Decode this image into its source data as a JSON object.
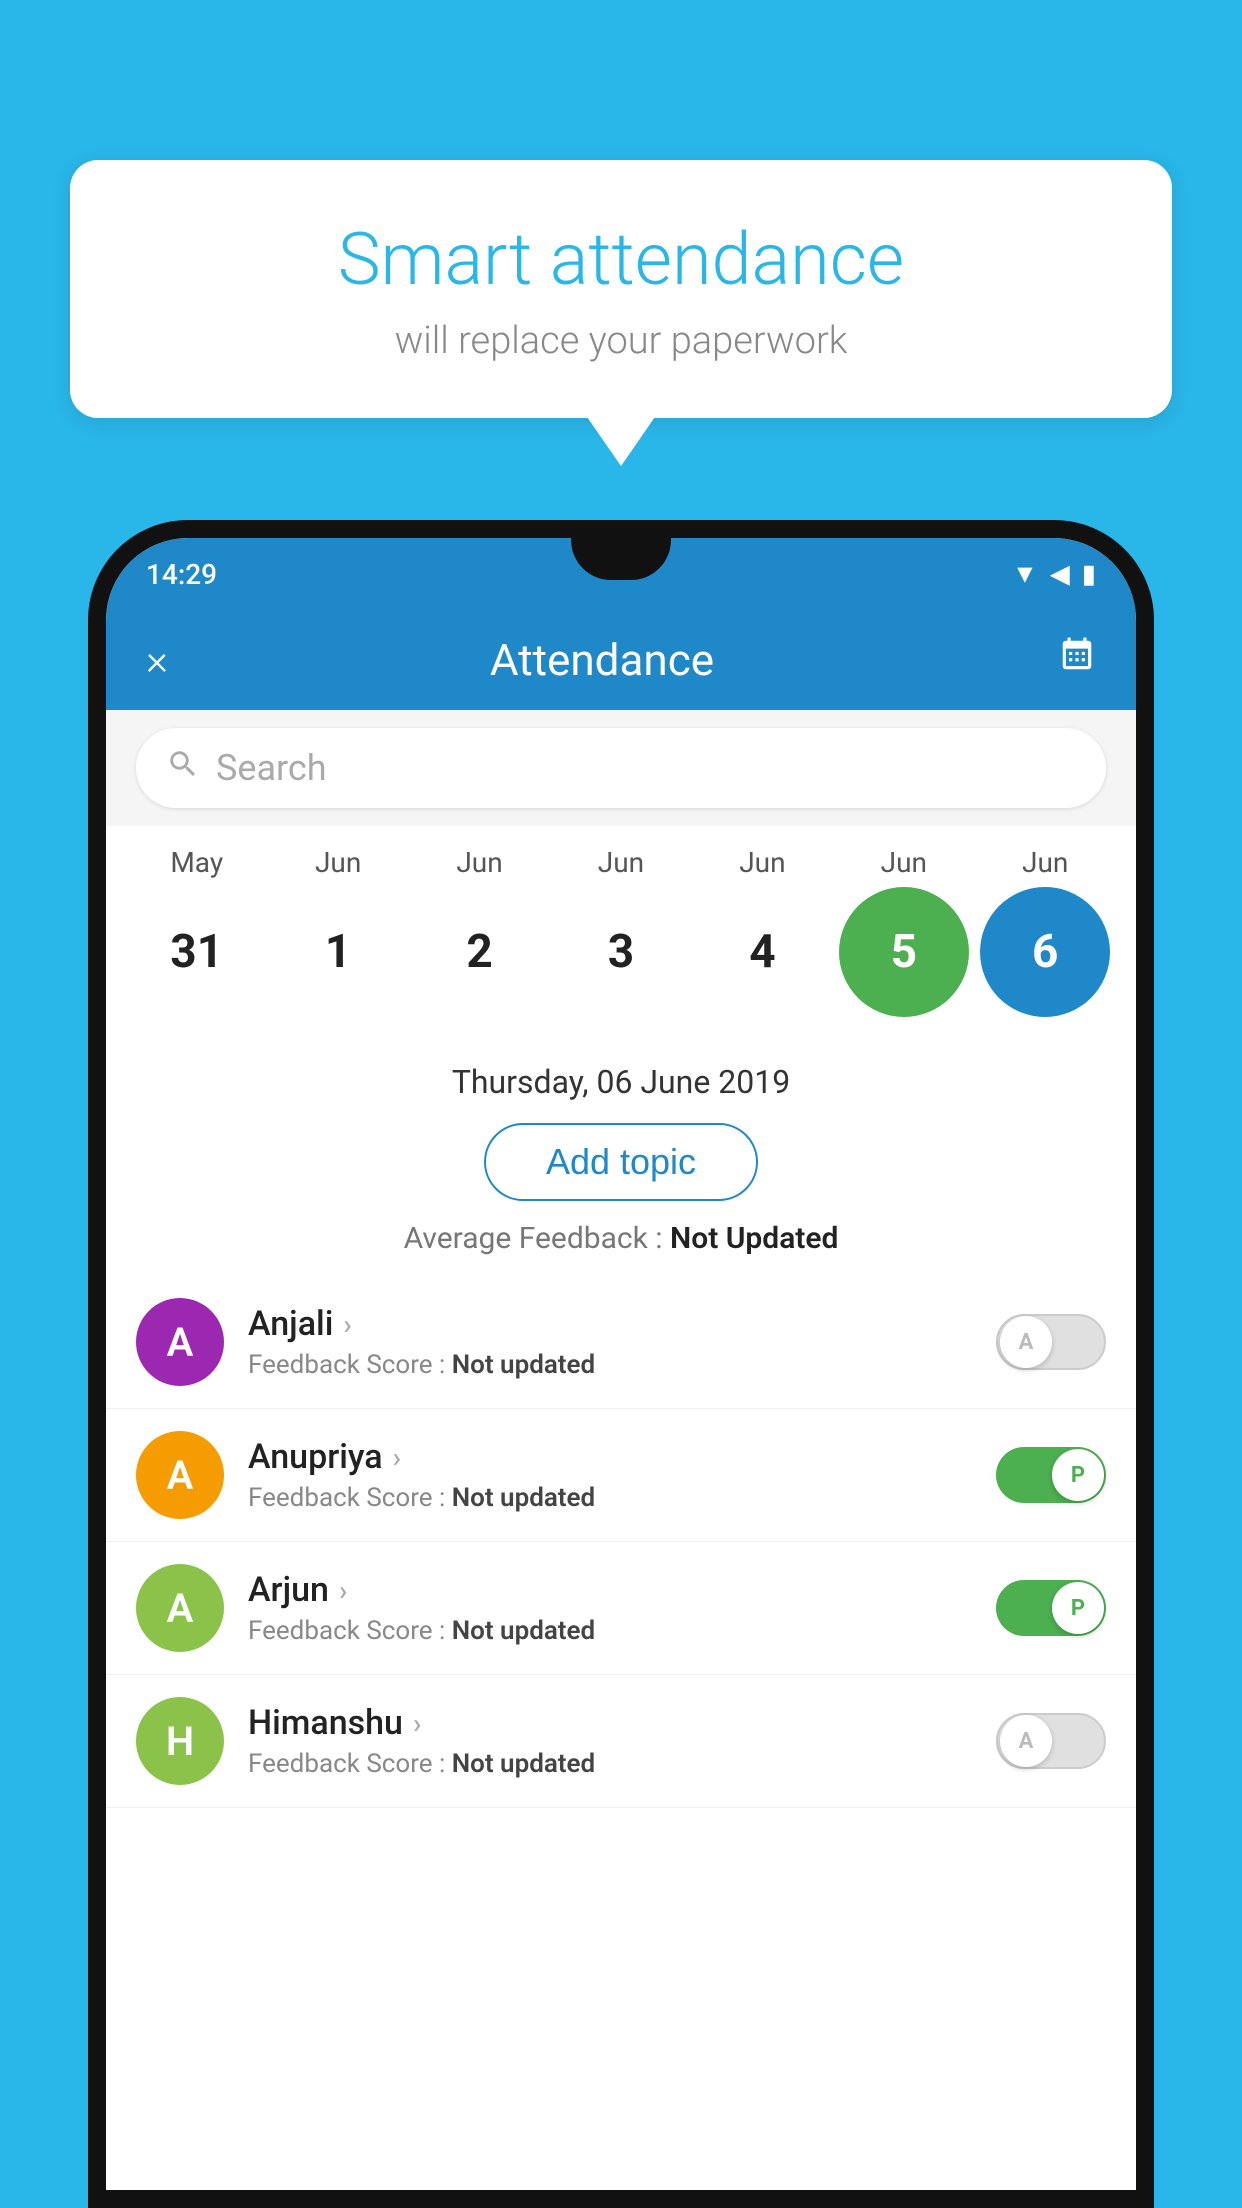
{
  "background_color": "#29B6E8",
  "speech_bubble": {
    "title": "Smart attendance",
    "subtitle": "will replace your paperwork"
  },
  "status_bar": {
    "time": "14:29"
  },
  "app_header": {
    "title": "Attendance",
    "close_label": "×",
    "calendar_icon": "calendar-icon"
  },
  "search": {
    "placeholder": "Search"
  },
  "calendar": {
    "months": [
      "May",
      "Jun",
      "Jun",
      "Jun",
      "Jun",
      "Jun",
      "Jun"
    ],
    "days": [
      "31",
      "1",
      "2",
      "3",
      "4",
      "5",
      "6"
    ],
    "states": [
      "normal",
      "normal",
      "normal",
      "normal",
      "normal",
      "selected-green",
      "selected-blue"
    ]
  },
  "selected_date": "Thursday, 06 June 2019",
  "add_topic_label": "Add topic",
  "average_feedback": {
    "label": "Average Feedback : ",
    "value": "Not Updated"
  },
  "students": [
    {
      "name": "Anjali",
      "feedback_label": "Feedback Score : ",
      "feedback_value": "Not updated",
      "avatar_letter": "A",
      "avatar_color": "#9C27B0",
      "toggle_state": "off",
      "toggle_label": "A"
    },
    {
      "name": "Anupriya",
      "feedback_label": "Feedback Score : ",
      "feedback_value": "Not updated",
      "avatar_letter": "A",
      "avatar_color": "#F59C00",
      "toggle_state": "on",
      "toggle_label": "P"
    },
    {
      "name": "Arjun",
      "feedback_label": "Feedback Score : ",
      "feedback_value": "Not updated",
      "avatar_letter": "A",
      "avatar_color": "#8BC34A",
      "toggle_state": "on",
      "toggle_label": "P"
    },
    {
      "name": "Himanshu",
      "feedback_label": "Feedback Score : ",
      "feedback_value": "Not updated",
      "avatar_letter": "H",
      "avatar_color": "#8BC34A",
      "toggle_state": "off",
      "toggle_label": "A"
    }
  ]
}
